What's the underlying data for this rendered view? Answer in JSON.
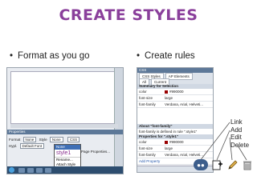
{
  "slide": {
    "title": "CREATE STYLES",
    "bullets": [
      {
        "bullet": "•",
        "text": "Format as you go"
      },
      {
        "bullet": "•",
        "text": "Create rules"
      }
    ]
  },
  "left_screenshot": {
    "panel_title": "Properties",
    "format_label": "Format",
    "format_value": "None",
    "style_label": "Style",
    "style_value": "None",
    "css_label": "CSS",
    "hyperlink_label": "Hypl.",
    "hyperlink_value": "Default Font",
    "menu": {
      "items": [
        "None",
        "style1",
        "",
        "Rename...",
        "Attach Style Sheet..."
      ]
    },
    "page_properties_label": "Page Properties..."
  },
  "right_screenshot": {
    "panel_header": "CSS",
    "tabs": [
      "CSS Styles",
      "AP Elements"
    ],
    "mode_tabs": [
      "All",
      "Current"
    ],
    "summary_label": "Summary for Selection",
    "properties": [
      {
        "name": "color",
        "value": "#990000"
      },
      {
        "name": "font-size",
        "value": "large"
      },
      {
        "name": "font-family",
        "value": "Verdana, Arial, Helveti..."
      }
    ],
    "about_label": "About \"font-family\"",
    "about_text": "font-family is defined in rule \".style1\"",
    "props_label": "Properties for \".style1\"",
    "rule_properties": [
      {
        "name": "color",
        "value": "#990000"
      },
      {
        "name": "font-size",
        "value": "large"
      },
      {
        "name": "font-family",
        "value": "Verdana, Arial, Helveti..."
      }
    ],
    "add_property": "Add Property"
  },
  "annotations": {
    "labels": [
      "Link",
      "Add",
      "Edit",
      "Delete"
    ]
  },
  "icons": [
    "link-style-sheet-icon",
    "new-rule-icon",
    "edit-pencil-icon",
    "delete-trash-icon"
  ],
  "colors": {
    "title": "#8a3f9b",
    "panel_header": "#5d7898",
    "swatch": "#990000"
  }
}
